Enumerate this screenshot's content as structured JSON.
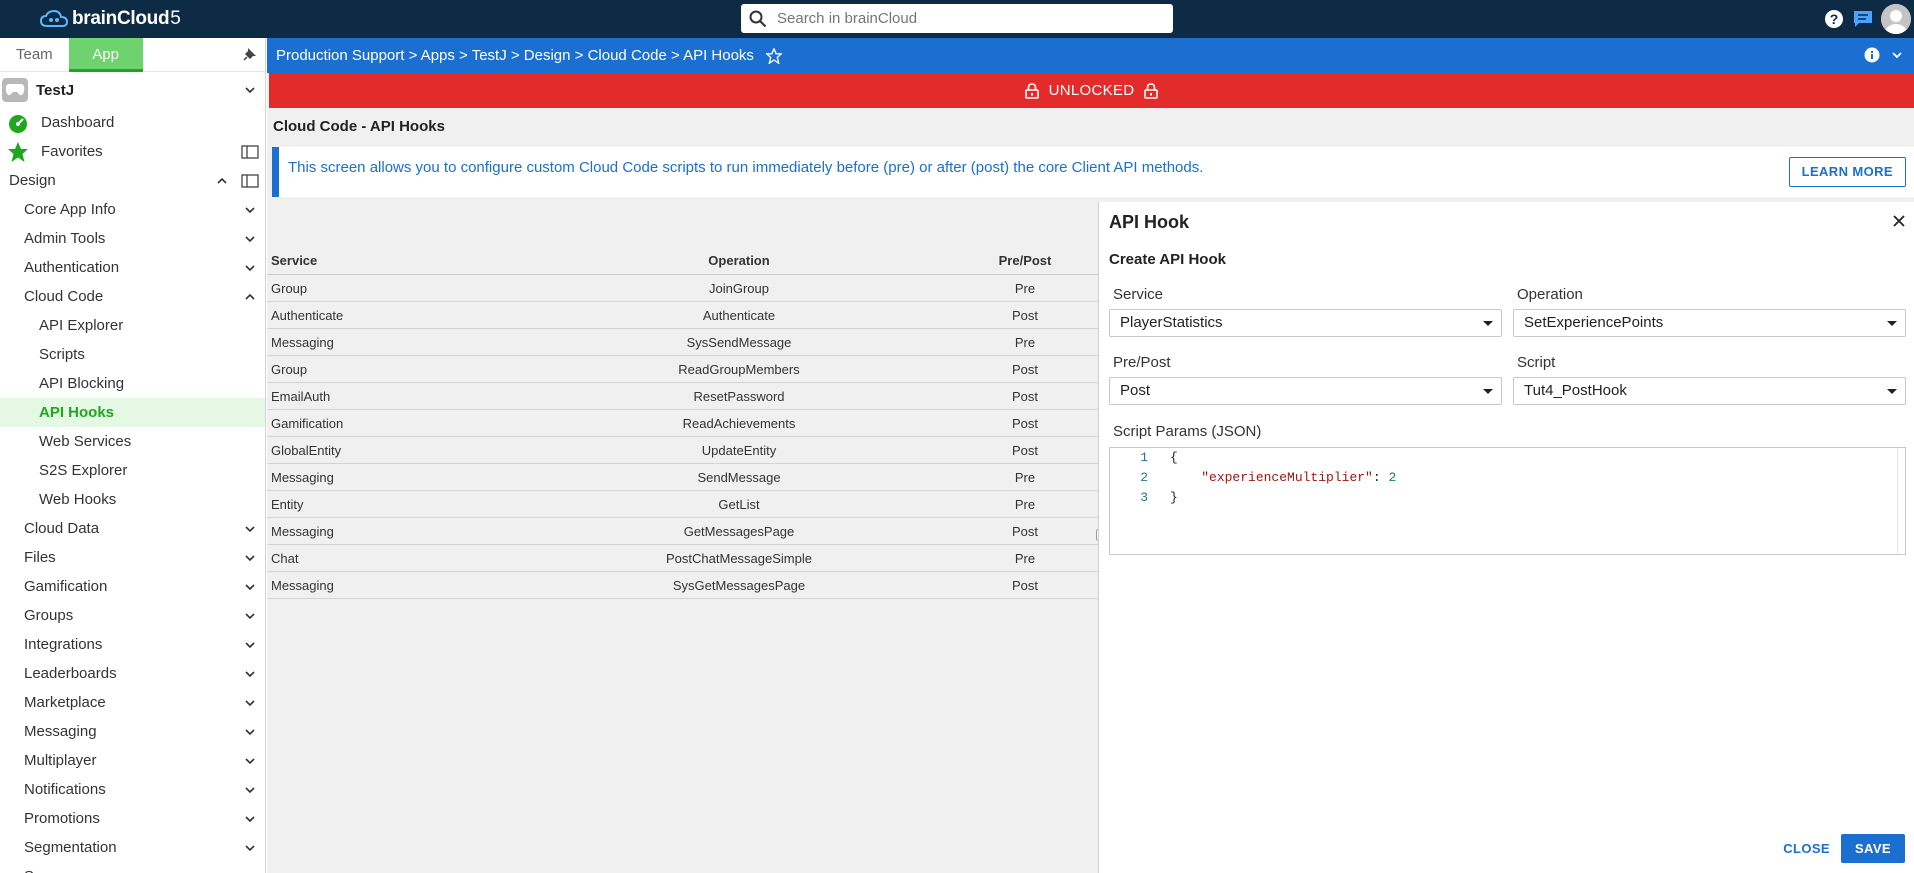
{
  "header": {
    "logo_brand": "brainCloud",
    "logo_version": "5",
    "search_placeholder": "Search in brainCloud"
  },
  "sidebar": {
    "tabs": [
      "Team",
      "App"
    ],
    "active_tab": "App",
    "app_name": "TestJ",
    "top_items": [
      "Dashboard",
      "Favorites"
    ],
    "section": "Design",
    "groups": [
      {
        "label": "Core App Info",
        "expanded": false
      },
      {
        "label": "Admin Tools",
        "expanded": false
      },
      {
        "label": "Authentication",
        "expanded": false
      },
      {
        "label": "Cloud Code",
        "expanded": true,
        "children": [
          "API Explorer",
          "Scripts",
          "API Blocking",
          "API Hooks",
          "Web Services",
          "S2S Explorer",
          "Web Hooks"
        ],
        "active_child": "API Hooks"
      },
      {
        "label": "Cloud Data",
        "expanded": false
      },
      {
        "label": "Files",
        "expanded": false
      },
      {
        "label": "Gamification",
        "expanded": false
      },
      {
        "label": "Groups",
        "expanded": false
      },
      {
        "label": "Integrations",
        "expanded": false
      },
      {
        "label": "Leaderboards",
        "expanded": false
      },
      {
        "label": "Marketplace",
        "expanded": false
      },
      {
        "label": "Messaging",
        "expanded": false
      },
      {
        "label": "Multiplayer",
        "expanded": false
      },
      {
        "label": "Notifications",
        "expanded": false
      },
      {
        "label": "Promotions",
        "expanded": false
      },
      {
        "label": "Segmentation",
        "expanded": false
      },
      {
        "label": "Servers",
        "expanded": false
      }
    ]
  },
  "breadcrumb": "Production Support > Apps > TestJ > Design > Cloud Code > API Hooks",
  "lock_banner": "UNLOCKED",
  "page": {
    "title": "Cloud Code - API Hooks",
    "info": "This screen allows you to configure custom Cloud Code scripts to run immediately before (pre) or after (post) the core Client API methods.",
    "learn_more": "LEARN MORE"
  },
  "table": {
    "headers": [
      "Service",
      "Operation",
      "Pre/Post"
    ],
    "rows": [
      [
        "Group",
        "JoinGroup",
        "Pre"
      ],
      [
        "Authenticate",
        "Authenticate",
        "Post"
      ],
      [
        "Messaging",
        "SysSendMessage",
        "Pre"
      ],
      [
        "Group",
        "ReadGroupMembers",
        "Post"
      ],
      [
        "EmailAuth",
        "ResetPassword",
        "Post"
      ],
      [
        "Gamification",
        "ReadAchievements",
        "Post"
      ],
      [
        "GlobalEntity",
        "UpdateEntity",
        "Post"
      ],
      [
        "Messaging",
        "SendMessage",
        "Pre"
      ],
      [
        "Entity",
        "GetList",
        "Pre"
      ],
      [
        "Messaging",
        "GetMessagesPage",
        "Post"
      ],
      [
        "Chat",
        "PostChatMessageSimple",
        "Pre"
      ],
      [
        "Messaging",
        "SysGetMessagesPage",
        "Post"
      ]
    ]
  },
  "panel": {
    "title": "API Hook",
    "subtitle": "Create API Hook",
    "service_label": "Service",
    "service_value": "PlayerStatistics",
    "operation_label": "Operation",
    "operation_value": "SetExperiencePoints",
    "prepost_label": "Pre/Post",
    "prepost_value": "Post",
    "script_label": "Script",
    "script_value": "Tut4_PostHook",
    "params_label": "Script Params (JSON)",
    "params_lines": [
      "{",
      "    \"experienceMultiplier\": 2",
      "}"
    ],
    "close_label": "CLOSE",
    "save_label": "SAVE"
  },
  "colors": {
    "topbar": "#0d2b45",
    "accent_blue": "#1a6fd1",
    "accent_green": "#1fa81f",
    "lock_red": "#e32b2b"
  }
}
